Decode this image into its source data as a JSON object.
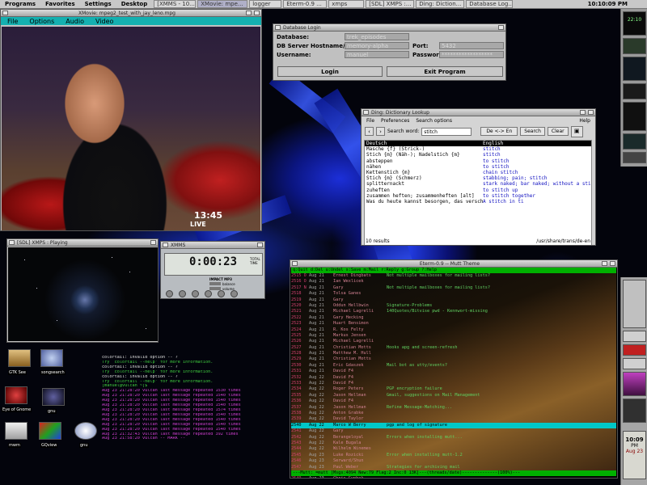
{
  "taskbar": {
    "menus": [
      "Programs",
      "Favorites",
      "Settings",
      "Desktop"
    ],
    "tasks": [
      "[XMMS - 10...",
      "XMovie: mpe...",
      "logger",
      "Eterm-0.9 ...",
      "xmps",
      "[SDL] XMPS :...",
      "Ding: Diction...",
      "Database Log..."
    ],
    "clock": "10:10:09 PM"
  },
  "movie": {
    "title": "XMovie: mpeg2_test_with_jay_leno.mpg",
    "menu": [
      "File",
      "Options",
      "Audio",
      "Video"
    ],
    "overlay_time": "13:45",
    "overlay_live": "LIVE"
  },
  "sdl": {
    "title": "[SDL] XMPS : Playing"
  },
  "xmms": {
    "title": "XMMS",
    "time": "0:00:23",
    "sub": "TOTAL TIME",
    "labels": [
      "IMPACT MP3",
      "balance",
      "volume"
    ]
  },
  "db": {
    "title": "Database Login",
    "fields": [
      {
        "label": "Database:",
        "value": "trek_episodes"
      },
      {
        "label": "DB Server Hostname/IP:",
        "value": "memory-alpha"
      },
      {
        "label": "Username:",
        "value": "manuel"
      }
    ],
    "port_label": "Port:",
    "port_value": "5432",
    "password_label": "Password:",
    "password_value": "******************",
    "login": "Login",
    "exit": "Exit Program"
  },
  "dict": {
    "title": "Ding: Dictionary Lookup",
    "menu": [
      "File",
      "Preferences",
      "Search options",
      "Help"
    ],
    "search_label": "Search word:",
    "search_value": "stitch",
    "lang": "De <-> En",
    "search_btn": "Search",
    "clear_btn": "Clear",
    "header": {
      "de": "Deutsch",
      "en": "English"
    },
    "rows": [
      {
        "de": "Masche {f} (Strick-)",
        "en": "stitch"
      },
      {
        "de": "Stich {m} (Näh-); Nadelstich {m}",
        "en": "stitch"
      },
      {
        "de": "absteppen",
        "en": "to stitch"
      },
      {
        "de": "nähen",
        "en": "to stitch"
      },
      {
        "de": "Kettenstich {m}",
        "en": "chain stitch"
      },
      {
        "de": "Stich {m} (Schmerz)",
        "en": "stabbing; pain; stitch"
      },
      {
        "de": "splitternackt",
        "en": "stark naked; bar naked; without a stitch"
      },
      {
        "de": "zuheften",
        "en": "to stitch up"
      },
      {
        "de": "zusammen heften; zusammenheften [alt]",
        "en": "to stitch together"
      },
      {
        "de": "Was du heute kannst besorgen, das verschiebe nicht auf morgen.",
        "en": "A stitch in ti"
      }
    ],
    "status_left": "10 results",
    "status_right": "/usr/share/trans/de-en"
  },
  "terminal": {
    "lines": [
      {
        "t": "colortail: invalid option -- ?",
        "c": "#e0e0e0"
      },
      {
        "t": "Try `colortail --help' for more information.",
        "c": "#40d040"
      },
      {
        "t": "colortail: invalid option -- ?",
        "c": "#e0e0e0"
      },
      {
        "t": "Try `colortail --help' for more information.",
        "c": "#40d040"
      },
      {
        "t": "colortail: invalid option -- ?",
        "c": "#e0e0e0"
      },
      {
        "t": "Try `colortail --help' for more information.",
        "c": "#40d040"
      },
      {
        "t": "[manuel@vulcan ~]$ ",
        "c": "#40d040"
      },
      {
        "t": "Aug 23 21:28:20 vulcan last message repeated 1530 times",
        "c": "#d040d0"
      },
      {
        "t": "Aug 23 21:28:20 vulcan last message repeated 1540 times",
        "c": "#d040d0"
      },
      {
        "t": "Aug 23 21:28:20 vulcan last message repeated 1540 times",
        "c": "#d040d0"
      },
      {
        "t": "Aug 23 21:28:20 vulcan last message repeated 1540 times",
        "c": "#d040d0"
      },
      {
        "t": "Aug 23 21:28:20 vulcan last message repeated 1574 times",
        "c": "#d040d0"
      },
      {
        "t": "Aug 23 21:28:20 vulcan last message repeated 1540 times",
        "c": "#d040d0"
      },
      {
        "t": "Aug 23 21:28:20 vulcan last message repeated 1540 times",
        "c": "#d040d0"
      },
      {
        "t": "Aug 23 21:28:20 vulcan last message repeated 1540 times",
        "c": "#d040d0"
      },
      {
        "t": "Aug 23 21:28:20 vulcan last message repeated 1540 times",
        "c": "#d040d0"
      },
      {
        "t": "Aug 23 21:32:43 vulcan last message repeated 392 times",
        "c": "#d040d0"
      },
      {
        "t": "Aug 23 21:58:20 vulcan -- MARK --",
        "c": "#d040d0"
      }
    ]
  },
  "mutt": {
    "title": "Eterm-0.9 -- Mutt Theme",
    "header": "q:Quit  d:Del  u:Undel  s:Save  m:Mail  r:Reply  g:Group  ?:Help",
    "rows": [
      {
        "n": "2515 O",
        "d": "Aug 21",
        "f": "Ernest Dingbats",
        "s": "Not multiple mailboxes for mailing lists?"
      },
      {
        "n": "2516 O",
        "d": "Aug 21",
        "f": "Ian Wexlicek",
        "s": ""
      },
      {
        "n": "2517 N",
        "d": "Aug 21",
        "f": "Gary",
        "s": "Not multiple mailboxes for mailing lists?"
      },
      {
        "n": "2518",
        "d": "Aug 21",
        "f": "Tolsa Ganes",
        "s": ""
      },
      {
        "n": "2519",
        "d": "Aug 21",
        "f": "Gary",
        "s": ""
      },
      {
        "n": "2520",
        "d": "Aug 21",
        "f": "Oddun Hellbwin",
        "s": "Signature-Problems"
      },
      {
        "n": "2521",
        "d": "Aug 21",
        "f": "Michael Lagrelli",
        "s": "140Quotes/Bitvise pwd - Kennwort-missing"
      },
      {
        "n": "2522",
        "d": "Aug 21",
        "f": "Gary Hecking",
        "s": ""
      },
      {
        "n": "2523",
        "d": "Aug 21",
        "f": "Huart Bensimon",
        "s": ""
      },
      {
        "n": "2524",
        "d": "Aug 21",
        "f": "R. Kos Felty",
        "s": ""
      },
      {
        "n": "2525",
        "d": "Aug 21",
        "f": "Markus Jensen",
        "s": ""
      },
      {
        "n": "2526",
        "d": "Aug 21",
        "f": "Michael Lagrelli",
        "s": ""
      },
      {
        "n": "2527",
        "d": "Aug 21",
        "f": "Christian Motts",
        "s": "Hooks apg and screen-refresh"
      },
      {
        "n": "2528",
        "d": "Aug 21",
        "f": "Matthew M. Hull",
        "s": ""
      },
      {
        "n": "2529",
        "d": "Aug 21",
        "f": "Christian Motts",
        "s": ""
      },
      {
        "n": "2530",
        "d": "Aug 21",
        "f": "Eric Gdaszek",
        "s": "Mail bot as utty/events?"
      },
      {
        "n": "2531",
        "d": "Aug 21",
        "f": "David F4",
        "s": ""
      },
      {
        "n": "2532",
        "d": "Aug 22",
        "f": "David F4",
        "s": ""
      },
      {
        "n": "2533",
        "d": "Aug 22",
        "f": "David F4",
        "s": ""
      },
      {
        "n": "2534",
        "d": "Aug 22",
        "f": "Roger Peters",
        "s": "PGP encryption failure"
      },
      {
        "n": "2535",
        "d": "Aug 22",
        "f": "Jason Hellman",
        "s": "Gmail, suggestions on Mail Management"
      },
      {
        "n": "2536",
        "d": "Aug 22",
        "f": "David F4",
        "s": ""
      },
      {
        "n": "2537",
        "d": "Aug 22",
        "f": "Jason Hellman",
        "s": "Refine Message-Matching..."
      },
      {
        "n": "2538",
        "d": "Aug 22",
        "f": "Anton Grabke",
        "s": ""
      },
      {
        "n": "2539",
        "d": "Aug 22",
        "f": "David Taylor",
        "s": ""
      },
      {
        "n": "2540",
        "d": "Aug 22",
        "f": "Marco W Berry",
        "s": "pgp and log of signature",
        "cur": true
      },
      {
        "n": "2541",
        "d": "Aug 22",
        "f": "Gary",
        "s": ""
      },
      {
        "n": "2542",
        "d": "Aug 22",
        "f": "Berangeloyal",
        "s": "Errors when installing mutt..."
      },
      {
        "n": "2543",
        "d": "Aug 22",
        "f": "Kale Bugala",
        "s": ""
      },
      {
        "n": "2544",
        "d": "Aug 22",
        "f": "Wilhelm Winemes",
        "s": ""
      },
      {
        "n": "2545",
        "d": "Aug 23",
        "f": "Luke Rozicki",
        "s": "Error when installing mutt-1.2"
      },
      {
        "n": "2546",
        "d": "Aug 23",
        "f": "Serward/Shun",
        "s": ""
      },
      {
        "n": "2547",
        "d": "Aug 23",
        "f": "Paul Weber",
        "s": "Strategies for archiving mail"
      },
      {
        "n": "2548",
        "d": "Aug 23",
        "f": "Christian Motts",
        "s": ""
      },
      {
        "n": "2549",
        "d": "Aug 23",
        "f": "Chris Gunbak",
        "s": ""
      },
      {
        "n": "2550",
        "d": "Aug 23",
        "f": "Kai Weber",
        "s": ""
      },
      {
        "n": "2551",
        "d": "Aug 23",
        "f": "Chris Gunbak",
        "s": ""
      }
    ],
    "footer": "---Mutt: =mutt [Msgs:4094 New:79 Flag:2 Inc:0 13K]---(threads/date)--------------(100%)---"
  },
  "desktop_icons": [
    {
      "label": "GTK See",
      "color": "#c0a060"
    },
    {
      "label": "songsearch",
      "color": "#6080c0"
    },
    {
      "label": "Eye of Gnome",
      "color": "#a02020"
    },
    {
      "label": "gnu",
      "color": "#202020"
    },
    {
      "label": "mwm",
      "color": "#d8d8d8"
    },
    {
      "label": "GQview",
      "color": "#8020a0"
    },
    {
      "label": "gnu",
      "color": "#a0a0c0"
    }
  ],
  "dock": {
    "clock_time": "10:09",
    "clock_ampm": "PM",
    "clock_day": "Aug 23",
    "clock_small": "22:10"
  }
}
